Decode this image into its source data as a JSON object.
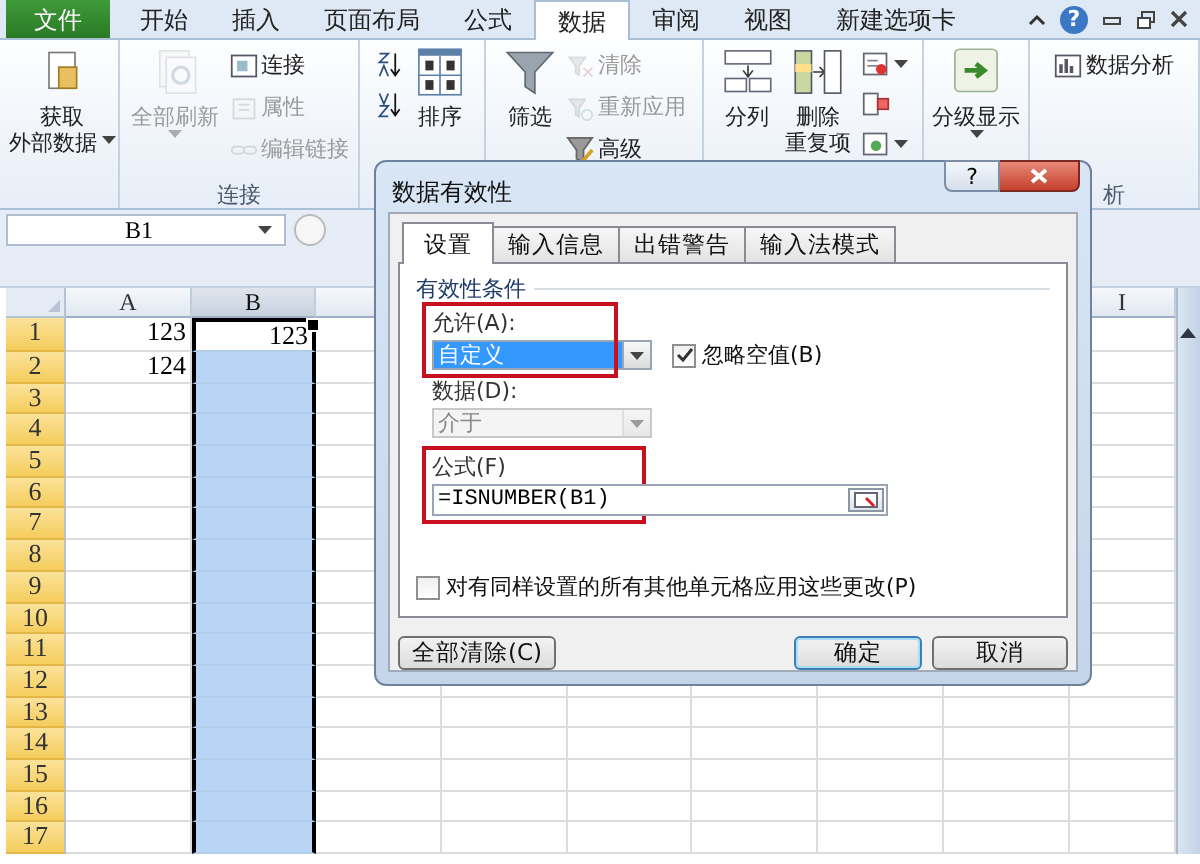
{
  "ribbon_tabs": [
    {
      "label": "文件",
      "kind": "file",
      "selected": false
    },
    {
      "label": "开始",
      "kind": "tab",
      "selected": false
    },
    {
      "label": "插入",
      "kind": "tab",
      "selected": false
    },
    {
      "label": "页面布局",
      "kind": "tab",
      "selected": false
    },
    {
      "label": "公式",
      "kind": "tab",
      "selected": false
    },
    {
      "label": "数据",
      "kind": "tab",
      "selected": true
    },
    {
      "label": "审阅",
      "kind": "tab",
      "selected": false
    },
    {
      "label": "视图",
      "kind": "tab",
      "selected": false
    },
    {
      "label": "新建选项卡",
      "kind": "tab",
      "selected": false
    }
  ],
  "help": "?",
  "ribbon_groups": [
    {
      "buttons": [
        {
          "kind": "large",
          "lines": [
            "获取",
            "外部数据"
          ],
          "dropdown": true,
          "disabled": false
        }
      ]
    },
    {
      "label": "连接",
      "buttons": [
        {
          "kind": "large",
          "lines": [
            "全部刷新"
          ],
          "dropdown": true,
          "disabled": true
        },
        {
          "kind": "small",
          "label": "连接",
          "disabled": false
        },
        {
          "kind": "small",
          "label": "属性",
          "disabled": true
        },
        {
          "kind": "small",
          "label": "编辑链接",
          "disabled": true
        }
      ]
    },
    {
      "buttons": [
        {
          "kind": "icon",
          "disabled": false
        },
        {
          "kind": "icon",
          "disabled": false
        },
        {
          "kind": "large",
          "lines": [
            "排序"
          ],
          "disabled": false
        }
      ]
    },
    {
      "buttons": [
        {
          "kind": "large",
          "lines": [
            "筛选"
          ],
          "disabled": false
        },
        {
          "kind": "small",
          "label": "清除",
          "disabled": true
        },
        {
          "kind": "small",
          "label": "重新应用",
          "disabled": true
        },
        {
          "kind": "small",
          "label": "高级",
          "disabled": false
        }
      ]
    },
    {
      "buttons": [
        {
          "kind": "large",
          "lines": [
            "分列"
          ],
          "disabled": false
        },
        {
          "kind": "large",
          "lines": [
            "删除",
            "重复项"
          ],
          "disabled": false
        },
        {
          "kind": "icon",
          "dropdown": true,
          "disabled": false
        },
        {
          "kind": "icon",
          "disabled": false
        },
        {
          "kind": "icon",
          "dropdown": true,
          "disabled": false
        }
      ]
    },
    {
      "buttons": [
        {
          "kind": "large",
          "lines": [
            "分级显示"
          ],
          "dropdown": true,
          "disabled": false
        }
      ]
    },
    {
      "label": "析",
      "buttons": [
        {
          "kind": "small",
          "label": "数据分析",
          "disabled": false
        }
      ]
    }
  ],
  "name_box": "B1",
  "sheet": {
    "columns": [
      {
        "label": "A",
        "selected": false
      },
      {
        "label": "B",
        "selected": true
      },
      {
        "label": "I",
        "selected": false
      }
    ],
    "rows": [
      {
        "label": "1",
        "selected": true,
        "cells": [
          {
            "value": "123",
            "active": false
          },
          {
            "value": "123",
            "active": true
          }
        ]
      },
      {
        "label": "2",
        "selected": true,
        "cells": [
          {
            "value": "124",
            "active": false
          }
        ]
      },
      {
        "label": "3",
        "selected": true
      },
      {
        "label": "4",
        "selected": true
      },
      {
        "label": "5",
        "selected": true
      },
      {
        "label": "6",
        "selected": true
      },
      {
        "label": "7",
        "selected": true
      },
      {
        "label": "8",
        "selected": true
      },
      {
        "label": "9",
        "selected": true
      },
      {
        "label": "10",
        "selected": true
      },
      {
        "label": "11",
        "selected": true
      },
      {
        "label": "12",
        "selected": true
      },
      {
        "label": "13",
        "selected": true
      },
      {
        "label": "14",
        "selected": true
      },
      {
        "label": "15",
        "selected": true
      },
      {
        "label": "16",
        "selected": true
      },
      {
        "label": "17",
        "selected": true
      }
    ]
  },
  "dialog": {
    "title": "数据有效性",
    "help": "?",
    "tabs": [
      {
        "label": "设置",
        "selected": true
      },
      {
        "label": "输入信息",
        "selected": false
      },
      {
        "label": "出错警告",
        "selected": false
      },
      {
        "label": "输入法模式",
        "selected": false
      }
    ],
    "section_title": "有效性条件",
    "allow": {
      "label": "允许(A):",
      "value": "自定义",
      "highlighted": true,
      "annotated": true
    },
    "ignore_blank": {
      "label": "忽略空值(B)",
      "checked": true
    },
    "data": {
      "label": "数据(D):",
      "value": "介于",
      "disabled": true
    },
    "formula": {
      "label": "公式(F)",
      "value": "=ISNUMBER(B1)",
      "annotated": true
    },
    "apply_all": {
      "label": "对有同样设置的所有其他单元格应用这些更改(P)",
      "checked": false
    },
    "buttons": [
      {
        "label": "全部清除(C)",
        "kind": "clear",
        "default": false
      },
      {
        "label": "确定",
        "kind": "ok",
        "default": true
      },
      {
        "label": "取消",
        "kind": "cancel",
        "default": false
      }
    ]
  }
}
